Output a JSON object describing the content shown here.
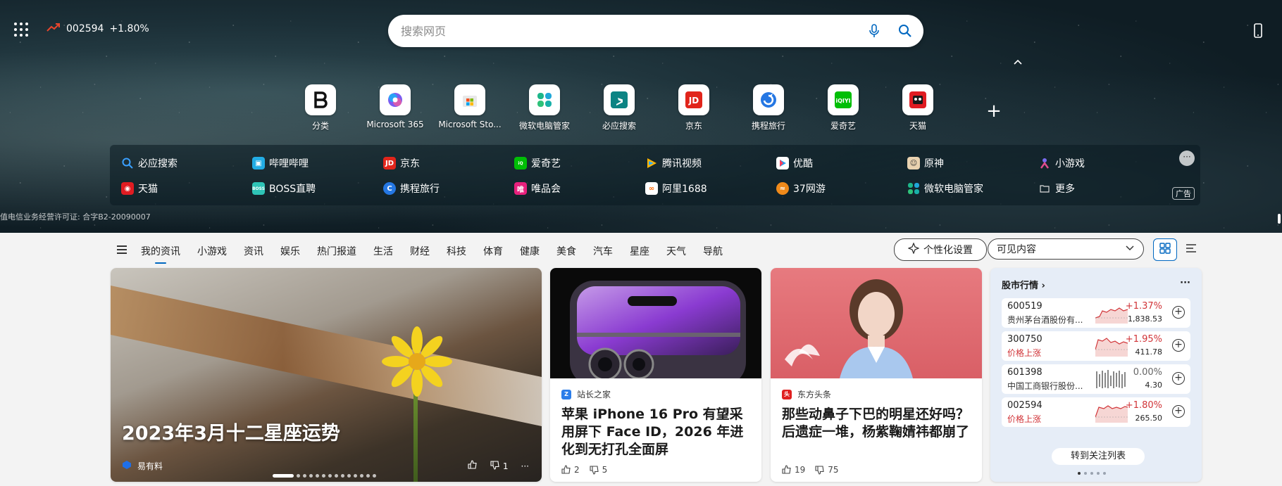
{
  "header": {
    "stock_code": "002594",
    "stock_change": "+1.80%",
    "search_placeholder": "搜索网页"
  },
  "quick_links": [
    {
      "label": "分类",
      "icon": "b-brand-icon"
    },
    {
      "label": "Microsoft 365",
      "icon": "microsoft365-icon"
    },
    {
      "label": "Microsoft Sto...",
      "icon": "microsoft-store-icon"
    },
    {
      "label": "微软电脑管家",
      "icon": "pc-manager-icon"
    },
    {
      "label": "必应搜索",
      "icon": "bing-icon"
    },
    {
      "label": "京东",
      "icon": "jd-icon"
    },
    {
      "label": "携程旅行",
      "icon": "ctrip-icon"
    },
    {
      "label": "爱奇艺",
      "icon": "iqiyi-icon"
    },
    {
      "label": "天猫",
      "icon": "tmall-icon"
    }
  ],
  "sites": {
    "row1": [
      "必应搜索",
      "哔哩哔哩",
      "京东",
      "爱奇艺",
      "腾讯视频",
      "优酷",
      "原神",
      "小游戏"
    ],
    "row2": [
      "天猫",
      "BOSS直聘",
      "携程旅行",
      "唯品会",
      "阿里1688",
      "37网游",
      "微软电脑管家",
      "更多"
    ],
    "ad_label": "广告",
    "more_dots": "···"
  },
  "license": "值电信业务经营许可证: 合字B2-20090007",
  "nav": {
    "tabs": [
      "我的资讯",
      "小游戏",
      "资讯",
      "娱乐",
      "热门报道",
      "生活",
      "财经",
      "科技",
      "体育",
      "健康",
      "美食",
      "汽车",
      "星座",
      "天气",
      "导航"
    ],
    "personalize": "个性化设置",
    "visible_content": "可见内容"
  },
  "hero_card": {
    "title": "2023年3月十二星座运势",
    "source": "易有料",
    "dislike_count": "1",
    "more": "···"
  },
  "news": [
    {
      "source": "站长之家",
      "title": "苹果 iPhone 16 Pro 有望采用屏下 Face ID，2026 年进化到无打孔全面屏",
      "likes": "2",
      "dislikes": "5"
    },
    {
      "source": "东方头条",
      "title": "那些动鼻子下巴的明星还好吗？后遗症一堆，杨紫鞠婧祎都崩了",
      "likes": "19",
      "dislikes": "75"
    }
  ],
  "stock_card": {
    "title": "股市行情",
    "more": "···",
    "rows": [
      {
        "code": "600519",
        "name": "贵州茅台酒股份有...",
        "change": "+1.37%",
        "price": "1,838.53",
        "trend": "up"
      },
      {
        "code": "300750",
        "name": "价格上涨",
        "change": "+1.95%",
        "price": "411.78",
        "trend": "up"
      },
      {
        "code": "601398",
        "name": "中国工商银行股份...",
        "change": "0.00%",
        "price": "4.30",
        "trend": "flat"
      },
      {
        "code": "002594",
        "name": "价格上涨",
        "change": "+1.80%",
        "price": "265.50",
        "trend": "up"
      }
    ],
    "follow_button": "转到关注列表"
  },
  "colors": {
    "accent": "#0067c0",
    "up": "#d13438"
  }
}
